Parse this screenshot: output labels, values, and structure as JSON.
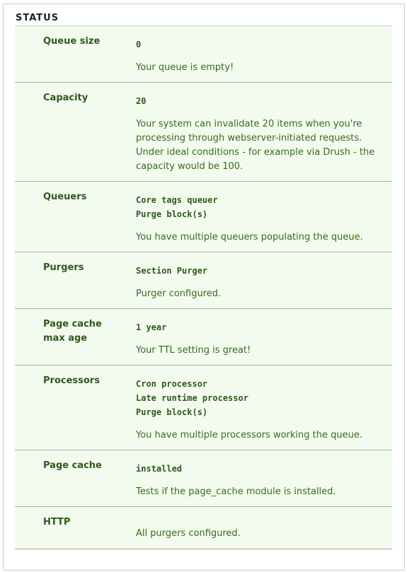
{
  "section": {
    "title": "STATUS"
  },
  "rows": [
    {
      "label": "Queue size",
      "values": [
        "0"
      ],
      "description": "Your queue is empty!"
    },
    {
      "label": "Capacity",
      "values": [
        "20"
      ],
      "description": "Your system can invalidate 20 items when you're processing through webserver-initiated requests. Under ideal conditions - for example via Drush - the capacity would be 100."
    },
    {
      "label": "Queuers",
      "values": [
        "Core tags queuer",
        "Purge block(s)"
      ],
      "description": "You have multiple queuers populating the queue."
    },
    {
      "label": "Purgers",
      "values": [
        "Section Purger"
      ],
      "description": "Purger configured."
    },
    {
      "label": "Page cache max age",
      "values": [
        "1 year"
      ],
      "description": "Your TTL setting is great!"
    },
    {
      "label": "Processors",
      "values": [
        "Cron processor",
        "Late runtime processor",
        "Purge block(s)"
      ],
      "description": "You have multiple processors working the queue."
    },
    {
      "label": "Page cache",
      "values": [
        "installed"
      ],
      "description": "Tests if the page_cache module is installed."
    },
    {
      "label": "HTTP",
      "values": [],
      "description": "All purgers configured."
    }
  ],
  "colors": {
    "row_background": "#f2fbee",
    "text_green": "#2f5a1b",
    "row_border": "#a9b2a1"
  }
}
